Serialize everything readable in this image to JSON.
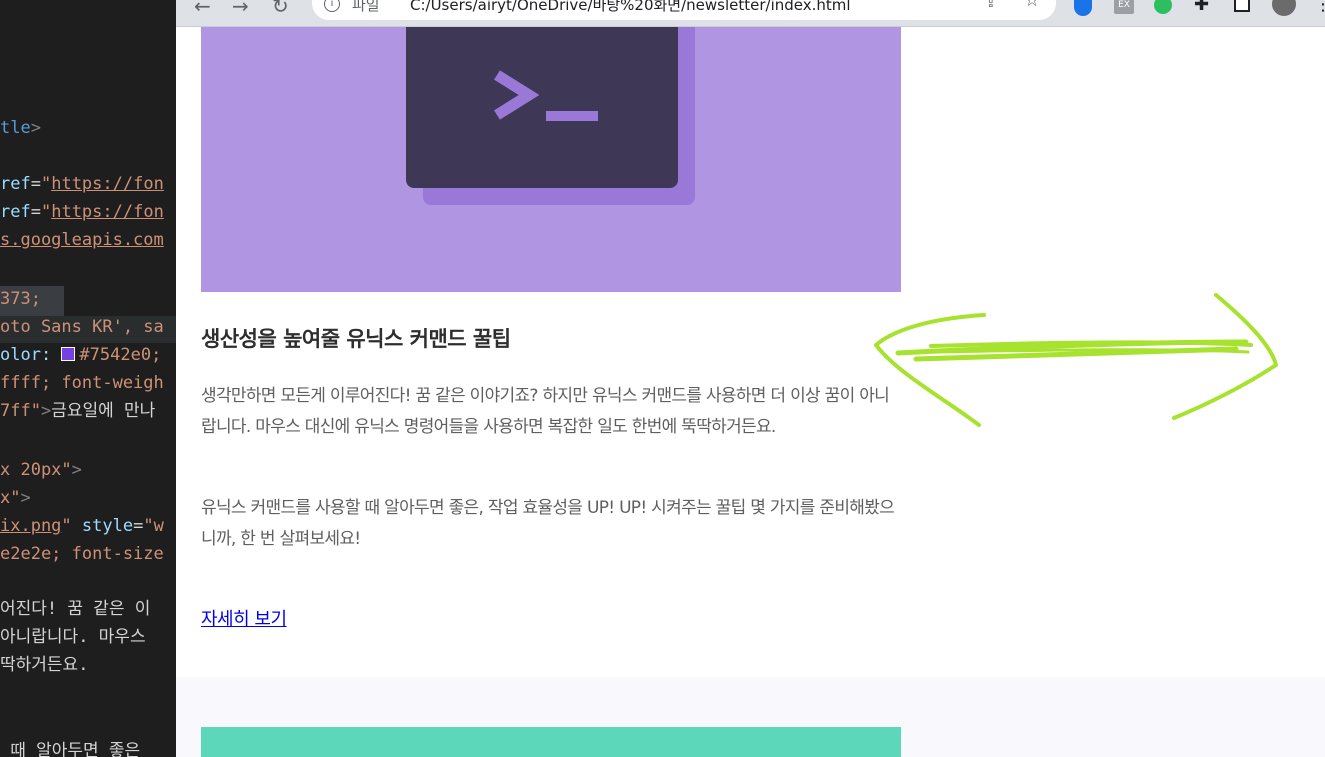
{
  "editor": {
    "lines": [
      {
        "parts": [
          {
            "cls": "tok-tag",
            "t": "tle"
          },
          {
            "cls": "tok-punct",
            "t": ">"
          }
        ]
      },
      {
        "parts": [
          {
            "cls": "tok-attr",
            "t": "ref"
          },
          {
            "cls": "tok-plain",
            "t": "="
          },
          {
            "cls": "tok-strp",
            "t": "\""
          },
          {
            "cls": "tok-str",
            "t": "https://fon"
          }
        ]
      },
      {
        "parts": [
          {
            "cls": "tok-attr",
            "t": "ref"
          },
          {
            "cls": "tok-plain",
            "t": "="
          },
          {
            "cls": "tok-strp",
            "t": "\""
          },
          {
            "cls": "tok-str",
            "t": "https://fon"
          }
        ]
      },
      {
        "parts": [
          {
            "cls": "tok-str",
            "t": "s.googleapis.com"
          }
        ]
      },
      {
        "parts": [
          {
            "cls": "tok-strp",
            "t": "373;"
          }
        ]
      },
      {
        "parts": [
          {
            "cls": "tok-strp",
            "t": "oto Sans KR', sa"
          }
        ]
      },
      {
        "parts": [
          {
            "cls": "tok-attr",
            "t": "olor: "
          },
          {
            "cls": "swatch",
            "t": ""
          },
          {
            "cls": "tok-strp",
            "t": "#7542e0;"
          }
        ]
      },
      {
        "parts": [
          {
            "cls": "tok-strp",
            "t": "ffff; font-weigh"
          }
        ]
      },
      {
        "parts": [
          {
            "cls": "tok-strp",
            "t": "7ff\""
          },
          {
            "cls": "tok-punct",
            "t": ">"
          },
          {
            "cls": "tok-plain",
            "t": "금요일에 만나"
          }
        ]
      },
      {
        "parts": [
          {
            "cls": "tok-strp",
            "t": "x 20px\""
          },
          {
            "cls": "tok-punct",
            "t": ">"
          }
        ]
      },
      {
        "parts": [
          {
            "cls": "tok-strp",
            "t": "x\""
          },
          {
            "cls": "tok-punct",
            "t": ">"
          }
        ]
      },
      {
        "parts": [
          {
            "cls": "tok-str",
            "t": "ix.png"
          },
          {
            "cls": "tok-strp",
            "t": "\" "
          },
          {
            "cls": "tok-attr",
            "t": "style"
          },
          {
            "cls": "tok-plain",
            "t": "="
          },
          {
            "cls": "tok-strp",
            "t": "\"w"
          }
        ]
      },
      {
        "parts": [
          {
            "cls": "tok-strp",
            "t": "e2e2e; font-size"
          }
        ]
      },
      {
        "parts": [
          {
            "cls": "tok-plain",
            "t": "어진다! 꿈 같은 이"
          }
        ]
      },
      {
        "parts": [
          {
            "cls": "tok-plain",
            "t": "아니랍니다. 마우스"
          }
        ]
      },
      {
        "parts": [
          {
            "cls": "tok-plain",
            "t": "딱하거든요."
          }
        ]
      },
      {
        "parts": [
          {
            "cls": "tok-plain",
            "t": " 때 알아두면 좋은"
          }
        ]
      }
    ]
  },
  "browser": {
    "scheme_label": "파일",
    "url": "C:/Users/airyt/OneDrive/바탕%20화면/newsletter/index.html",
    "back_icon": "←",
    "forward_icon": "→",
    "reload_icon": "↻",
    "share_icon": "⇪",
    "star_icon": "☆",
    "extensions_icon": "✚",
    "menu_icon": "⋮",
    "ext_label": "EX"
  },
  "article": {
    "title": "생산성을 높여줄 유닉스 커맨드 꿀팁",
    "paragraph_1": "생각만하면 모든게 이루어진다! 꿈 같은 이야기죠? 하지만 유닉스 커맨드를 사용하면 더 이상 꿈이 아니랍니다. 마우스 대신에 유닉스 명령어들을 사용하면 복잡한 일도 한번에 뚝딱하거든요.",
    "paragraph_2": "유닉스 커맨드를 사용할 때 알아두면 좋은, 작업 효율성을 UP! UP! 시켜주는 꿀팁 몇 가지를 준비해봤으니까, 한 번 살펴보세요!",
    "link_label": "자세히 보기"
  },
  "colors": {
    "hero_bg": "#b095e2",
    "terminal_bg": "#3e3856",
    "next_hero_bg": "#5cd7b9",
    "scribble": "#a6e22e",
    "link": "#0000ee"
  }
}
